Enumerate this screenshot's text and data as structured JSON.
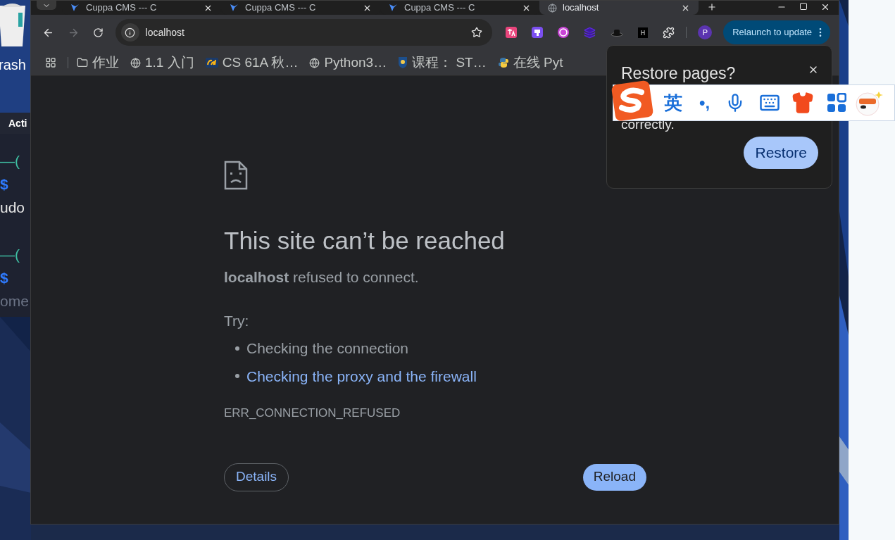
{
  "desktop": {
    "trash_label": "rash",
    "terminal": {
      "title": "Acti",
      "groups": [
        [
          {
            "kind": "prompt_top",
            "text": "—("
          },
          {
            "kind": "prompt",
            "text": "$"
          },
          {
            "kind": "output",
            "text": "udo"
          }
        ],
        [
          {
            "kind": "prompt_top",
            "text": "—("
          },
          {
            "kind": "prompt",
            "text": "$"
          },
          {
            "kind": "dim",
            "text": "ome"
          }
        ]
      ]
    }
  },
  "browser": {
    "tabs": [
      {
        "title": "Cuppa CMS --- C",
        "selected": false
      },
      {
        "title": "Cuppa CMS --- C",
        "selected": false
      },
      {
        "title": "Cuppa CMS --- C",
        "selected": false
      },
      {
        "title": "localhost",
        "selected": true
      }
    ],
    "address": {
      "value": "localhost"
    },
    "relaunch_button": "Relaunch to update",
    "profile_initial": "P",
    "bookmarks": [
      {
        "kind": "folder",
        "label": "作业"
      },
      {
        "kind": "globe",
        "label": "1.1 入门"
      },
      {
        "kind": "cal",
        "label": "CS 61A 秋…"
      },
      {
        "kind": "globe",
        "label": "Python3…"
      },
      {
        "kind": "crest",
        "label": "课程： ST…"
      },
      {
        "kind": "python",
        "label": "在线 Pyt"
      }
    ],
    "error_page": {
      "heading": "This site can’t be reached",
      "message": "**localhost** refused to connect.",
      "try_label": "Try:",
      "suggestions": [
        {
          "kind": "text",
          "text": "Checking the connection"
        },
        {
          "kind": "link",
          "text": "Checking the proxy and the firewall"
        }
      ],
      "error_code": "ERR_CONNECTION_REFUSED",
      "details_button": "Details",
      "reload_button": "Reload"
    },
    "restore_popup": {
      "title": "Restore pages?",
      "message": "correctly.",
      "restore_button": "Restore"
    }
  },
  "ime_toolbar": {
    "language": "英",
    "punctuation": "•,"
  }
}
